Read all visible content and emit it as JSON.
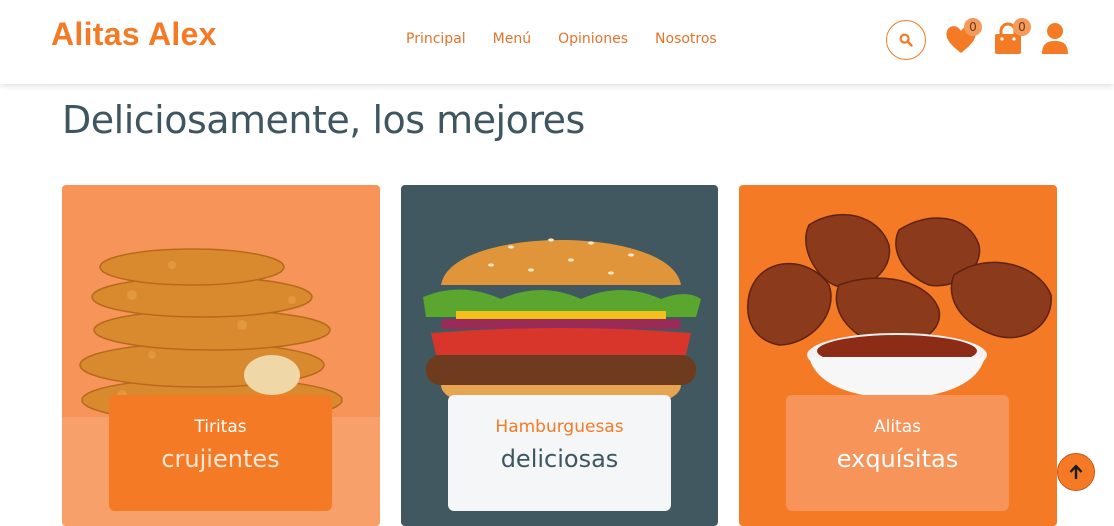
{
  "brand": {
    "name": "Alitas Alex",
    "accent": "#f47a25",
    "dark": "#415860"
  },
  "nav": {
    "items": [
      {
        "label": "Principal"
      },
      {
        "label": "Menú"
      },
      {
        "label": "Opiniones"
      },
      {
        "label": "Nosotros"
      }
    ]
  },
  "header_icons": {
    "search": "search-icon",
    "favorites": {
      "icon": "heart-icon",
      "count": "0"
    },
    "cart": {
      "icon": "shopping-bag-icon",
      "count": "0"
    },
    "account": "user-icon"
  },
  "section": {
    "title": "Deliciosamente, los mejores"
  },
  "cards": [
    {
      "image": "chicken-tenders-image",
      "top": "Tiritas",
      "bottom": "crujientes"
    },
    {
      "image": "burger-image",
      "top": "Hamburguesas",
      "bottom": "deliciosas"
    },
    {
      "image": "chicken-wings-image",
      "top": "Alitas",
      "bottom": "exquísitas"
    }
  ],
  "scroll_top": {
    "icon": "arrow-up-icon"
  }
}
